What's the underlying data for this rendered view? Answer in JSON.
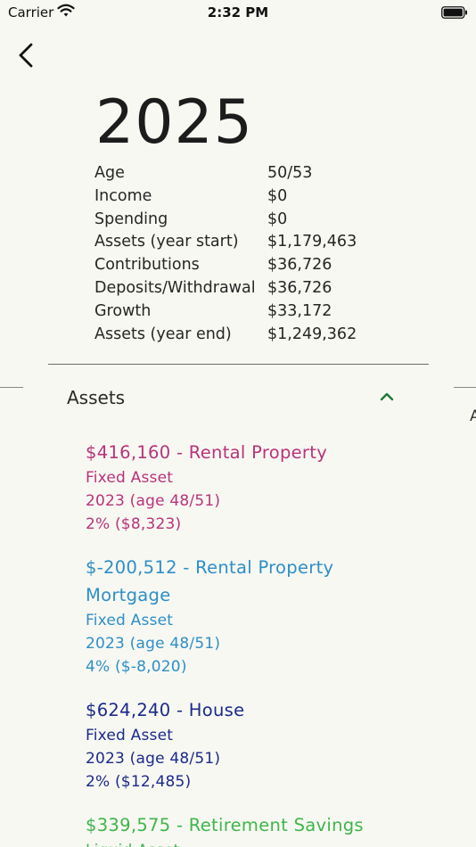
{
  "status_bar": {
    "carrier": "Carrier",
    "time": "2:32 PM"
  },
  "year": "2025",
  "summary": [
    {
      "label": "Age",
      "value": "50/53"
    },
    {
      "label": "Income",
      "value": "$0"
    },
    {
      "label": "Spending",
      "value": "$0"
    },
    {
      "label": "Assets (year start)",
      "value": "$1,179,463"
    },
    {
      "label": "Contributions",
      "value": "$36,726"
    },
    {
      "label": "Deposits/Withdrawal",
      "value": "$36,726"
    },
    {
      "label": "Growth",
      "value": "$33,172"
    },
    {
      "label": "Assets (year end)",
      "value": "$1,249,362"
    }
  ],
  "assets_section": {
    "title": "Assets",
    "edge_peek": "A",
    "items": [
      {
        "title_line1": "$416,160 - Rental Property",
        "title_line2": "",
        "type": "Fixed Asset",
        "start": "2023 (age 48/51)",
        "growth": "2% ($8,323)",
        "color": "#b8337a"
      },
      {
        "title_line1": "$-200,512 - Rental Property",
        "title_line2": "Mortgage",
        "type": "Fixed Asset",
        "start": "2023 (age 48/51)",
        "growth": "4% ($-8,020)",
        "color": "#2d8fc8"
      },
      {
        "title_line1": "$624,240 - House",
        "title_line2": "",
        "type": "Fixed Asset",
        "start": "2023 (age 48/51)",
        "growth": "2% ($12,485)",
        "color": "#1a2a8a"
      },
      {
        "title_line1": "$339,575 - Retirement Savings",
        "title_line2": "",
        "type": "Liquid Asset",
        "start": "",
        "growth": "",
        "color": "#3db64a"
      }
    ]
  },
  "colors": {
    "background": "#f8f8f2",
    "collapse_chevron": "#1f7a3a"
  }
}
